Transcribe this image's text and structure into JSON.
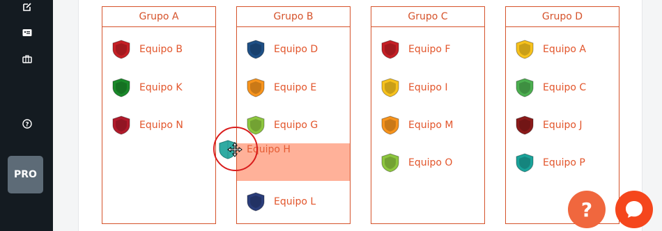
{
  "sidebar": {
    "icons": [
      "edit-icon",
      "id-card-icon",
      "briefcase-icon",
      "help-circle-icon"
    ],
    "pro_label": "PRO"
  },
  "colors": {
    "accent": "#d5522a",
    "team_text": "#e2552b",
    "drop_highlight": "#ffb199",
    "sidebar_bg": "#141b21"
  },
  "groups": [
    {
      "title": "Grupo A",
      "teams": [
        {
          "name": "Equipo B",
          "color": "#c62026",
          "icon": "shield-icon"
        },
        {
          "name": "Equipo K",
          "color": "#1a8a2a",
          "icon": "shield-icon"
        },
        {
          "name": "Equipo N",
          "color": "#b11a2b",
          "icon": "shield-icon"
        }
      ]
    },
    {
      "title": "Grupo B",
      "teams": [
        {
          "name": "Equipo D",
          "color": "#1e4f85",
          "icon": "shield-icon"
        },
        {
          "name": "Equipo E",
          "color": "#f7941d",
          "icon": "shield-icon"
        },
        {
          "name": "Equipo G",
          "color": "#8dc63f",
          "icon": "shield-icon"
        },
        {
          "name": "Equipo L",
          "color": "#2a3d7a",
          "icon": "shield-icon"
        }
      ]
    },
    {
      "title": "Grupo C",
      "teams": [
        {
          "name": "Equipo F",
          "color": "#c62026",
          "icon": "shield-icon"
        },
        {
          "name": "Equipo I",
          "color": "#f7c21d",
          "icon": "shield-icon"
        },
        {
          "name": "Equipo M",
          "color": "#f7941d",
          "icon": "shield-icon"
        },
        {
          "name": "Equipo O",
          "color": "#8dc63f",
          "icon": "shield-icon"
        }
      ]
    },
    {
      "title": "Grupo D",
      "teams": [
        {
          "name": "Equipo A",
          "color": "#f7c21d",
          "icon": "shield-icon"
        },
        {
          "name": "Equipo C",
          "color": "#4caf50",
          "icon": "shield-icon"
        },
        {
          "name": "Equipo J",
          "color": "#8b1a1a",
          "icon": "shield-icon"
        },
        {
          "name": "Equipo P",
          "color": "#1aa39a",
          "icon": "shield-icon"
        }
      ]
    }
  ],
  "dragging": {
    "name": "Equipo H",
    "color": "#1aa39a",
    "icon": "shield-icon"
  },
  "help_label": "?"
}
